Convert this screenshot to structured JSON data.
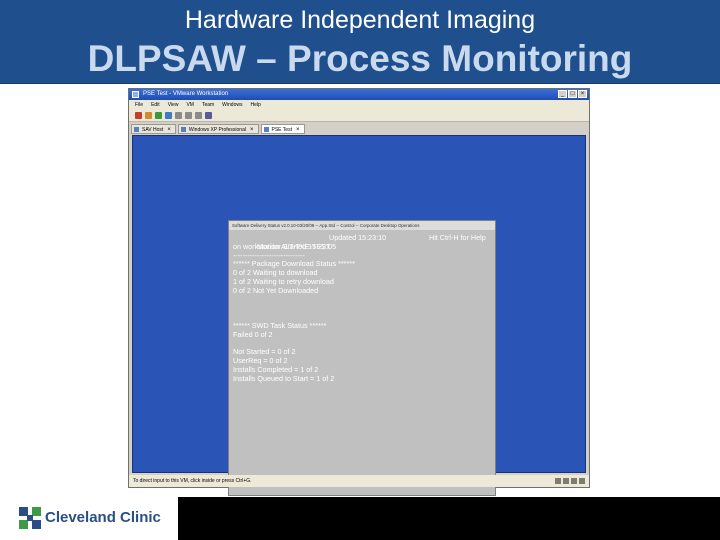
{
  "slide": {
    "subtitle": "Hardware Independent Imaging",
    "title": "DLPSAW – Process Monitoring"
  },
  "vmware": {
    "window_title": "PSE Test - VMware Workstation",
    "menu": [
      "File",
      "Edit",
      "View",
      "VM",
      "Team",
      "Windows",
      "Help"
    ],
    "tabs": [
      {
        "label": "SAV Host",
        "active": false
      },
      {
        "label": "Windows XP Professional",
        "active": false
      },
      {
        "label": "PSE Test",
        "active": true
      }
    ],
    "status_text": "To direct input to this VM, click inside or press Ctrl+G.",
    "toolbar_icons": [
      "stop-icon",
      "pause-icon",
      "play-icon",
      "reset-icon",
      "snapshot-icon",
      "revert-icon",
      "manage-snapshots-icon",
      "fullscreen-icon"
    ]
  },
  "console": {
    "title": "Software Delivery Status v2.0.10-03/20/09 -- App.Std -- Control -- Corporate Desktop Operations",
    "monitor_started": "Monitor Started 15:22:05",
    "updated": "Updated 15:23:10",
    "help_hint": "Hit Ctrl-H for Help",
    "workstation": "on workstation ALT-TXE-TEST",
    "separator": "------------------------------",
    "package_header": "****** Package Download Status ******",
    "package_lines": [
      "0 of 2 Waiting to download",
      "1 of 2 Waiting to retry download",
      "0 of 2 Not Yet Downloaded"
    ],
    "swd_header": "****** SWD Task Status ******",
    "swd_failed": "Failed 0 of 2",
    "install_lines": [
      "Not Started = 0 of 2",
      "UserReq = 0 of 2",
      "Installs Completed = 1 of 2",
      "Installs Queued to Start = 1 of 2"
    ]
  },
  "footer": {
    "logo_text": "Cleveland Clinic"
  },
  "colors": {
    "banner": "#1f4f8c",
    "title_text": "#c9d9ee",
    "vm_screen": "#2a54b5",
    "console_bg": "#c0c0c0",
    "logo_blue": "#2a4f86"
  }
}
